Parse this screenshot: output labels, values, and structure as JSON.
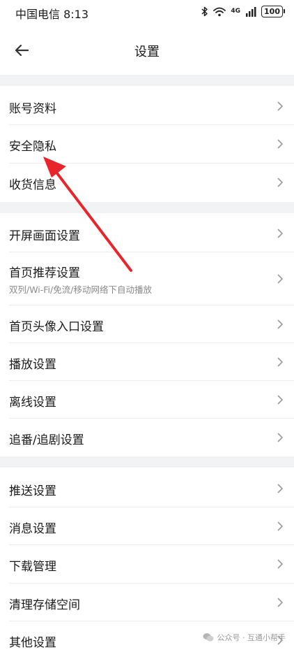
{
  "status_bar": {
    "carrier_time": "中国电信 8:13",
    "network": "4G",
    "battery": "100"
  },
  "header": {
    "title": "设置"
  },
  "groups": [
    {
      "items": [
        {
          "label": "账号资料"
        },
        {
          "label": "安全隐私"
        },
        {
          "label": "收货信息"
        }
      ]
    },
    {
      "items": [
        {
          "label": "开屏画面设置"
        },
        {
          "label": "首页推荐设置",
          "sub": "双列/Wi-Fi/免流/移动网络下自动播放"
        },
        {
          "label": "首页头像入口设置"
        },
        {
          "label": "播放设置"
        },
        {
          "label": "离线设置"
        },
        {
          "label": "追番/追剧设置"
        }
      ]
    },
    {
      "items": [
        {
          "label": "推送设置"
        },
        {
          "label": "消息设置"
        },
        {
          "label": "下载管理"
        },
        {
          "label": "清理存储空间"
        },
        {
          "label": "其他设置"
        }
      ]
    }
  ],
  "watermark": "公众号 · 互通小帮手",
  "colors": {
    "annotation_arrow": "#e8252b",
    "separator": "#f2f3f5"
  }
}
